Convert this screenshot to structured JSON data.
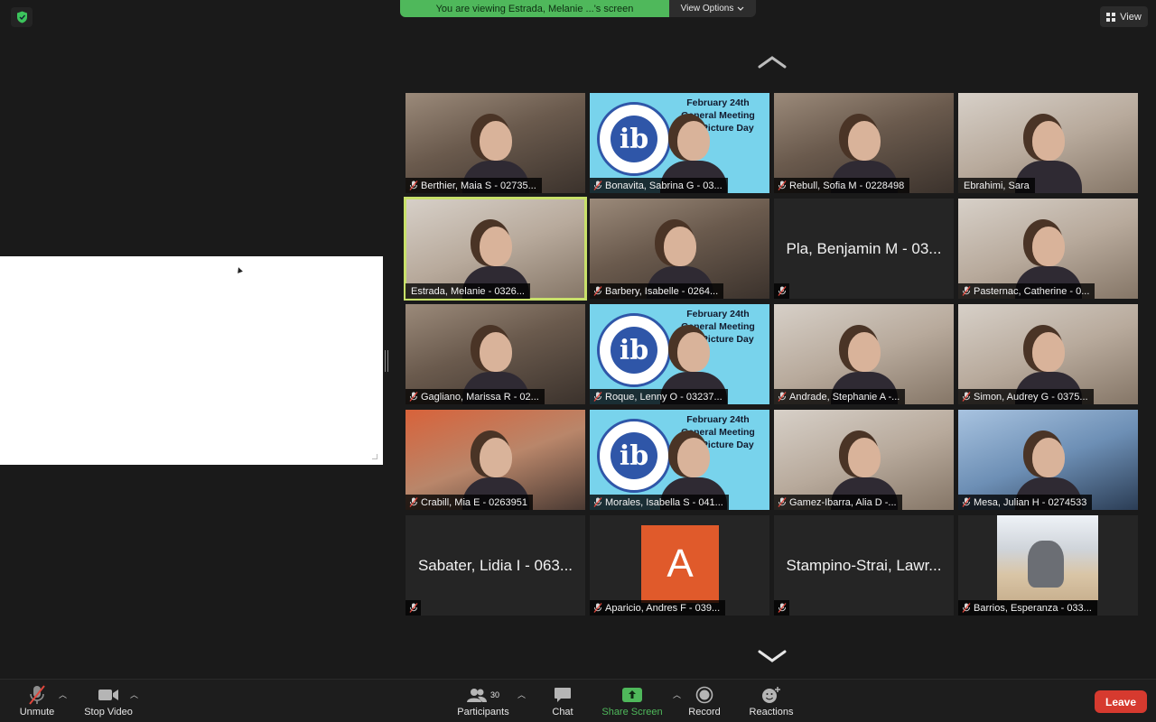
{
  "banner": {
    "text": "You are viewing Estrada, Melanie ...'s screen",
    "view_options": "View Options"
  },
  "view_button": {
    "label": "View"
  },
  "tiles": [
    {
      "type": "camera",
      "name": "Berthier, Maia S - 02735...",
      "muted": true
    },
    {
      "type": "ib",
      "name": "Bonavita, Sabrina G - 03...",
      "muted": true
    },
    {
      "type": "camera",
      "name": "Rebull, Sofia M - 0228498",
      "muted": true
    },
    {
      "type": "camera",
      "name": "Ebrahimi, Sara",
      "muted": false
    },
    {
      "type": "camera",
      "name": "Estrada, Melanie - 0326...",
      "muted": false,
      "active": true
    },
    {
      "type": "camera",
      "name": "Barbery, Isabelle - 0264...",
      "muted": true
    },
    {
      "type": "name-only",
      "name": "Pla, Benjamin M - 03...",
      "muted": true
    },
    {
      "type": "camera",
      "name": "Pasternac, Catherine - 0...",
      "muted": true
    },
    {
      "type": "camera",
      "name": "Gagliano, Marissa R - 02...",
      "muted": true
    },
    {
      "type": "ib",
      "name": "Roque, Lenny O - 03237...",
      "muted": true
    },
    {
      "type": "camera",
      "name": "Andrade, Stephanie A -...",
      "muted": true
    },
    {
      "type": "camera",
      "name": "Simon, Audrey G - 0375...",
      "muted": true
    },
    {
      "type": "camera",
      "name": "Crabill, Mia E - 0263951",
      "muted": true
    },
    {
      "type": "ib",
      "name": "Morales, Isabella S - 041...",
      "muted": true
    },
    {
      "type": "camera",
      "name": "Gamez-Ibarra, Alia D -...",
      "muted": true
    },
    {
      "type": "camera",
      "name": "Mesa, Julian H - 0274533",
      "muted": true
    },
    {
      "type": "name-only",
      "name": "Sabater, Lidia I - 063...",
      "muted": true
    },
    {
      "type": "avatar",
      "name": "Aparicio, Andres F - 039...",
      "initial": "A",
      "muted": true
    },
    {
      "type": "name-only",
      "name": "Stampino-Strai, Lawr...",
      "muted": true
    },
    {
      "type": "dog",
      "name": "Barrios, Esperanza - 033...",
      "muted": true
    }
  ],
  "ib_slide": {
    "logo": "ib",
    "title": "February 24th General Meeting and Picture Day"
  },
  "toolbar": {
    "unmute": "Unmute",
    "stop_video": "Stop Video",
    "participants": "Participants",
    "participants_count": "30",
    "chat": "Chat",
    "share_screen": "Share Screen",
    "record": "Record",
    "reactions": "Reactions",
    "leave": "Leave"
  },
  "colors": {
    "share_green": "#4fb85b",
    "leave_red": "#d63a2f",
    "active_speaker": "#c8e06a",
    "mute_red": "#e0463c"
  }
}
